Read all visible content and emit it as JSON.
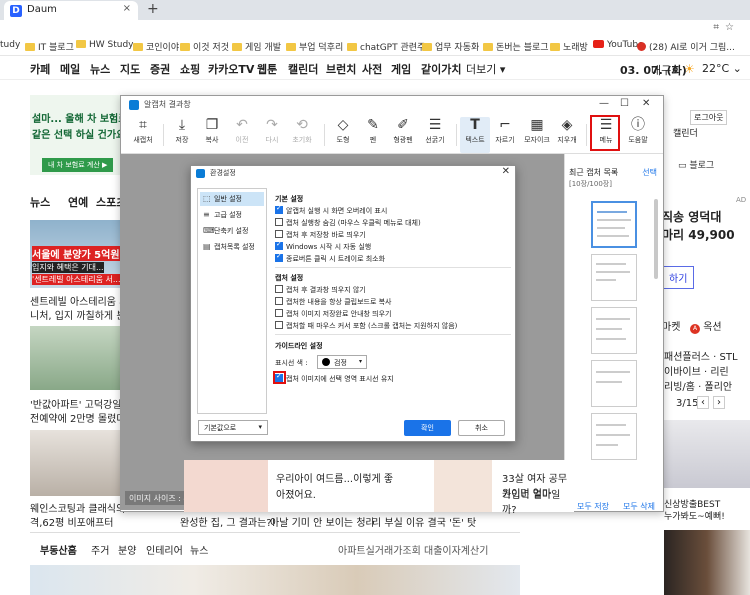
{
  "browser": {
    "tab_title": "Daum",
    "tab_close": "×",
    "new_tab": "+",
    "bookmarks": [
      {
        "label": "tudy",
        "icon": "none"
      },
      {
        "label": "IT 블로그",
        "icon": "folder"
      },
      {
        "label": "HW Study",
        "icon": "folder"
      },
      {
        "label": "코인이야",
        "icon": "folder"
      },
      {
        "label": "이것 저것",
        "icon": "folder"
      },
      {
        "label": "게임 개발",
        "icon": "folder"
      },
      {
        "label": "부업 덕후리",
        "icon": "folder"
      },
      {
        "label": "chatGPT 관련주",
        "icon": "folder"
      },
      {
        "label": "업무 자동화",
        "icon": "folder"
      },
      {
        "label": "돈버는 블로그",
        "icon": "folder"
      },
      {
        "label": "노래방",
        "icon": "folder"
      },
      {
        "label": "YouTube",
        "icon": "youtube"
      },
      {
        "label": "(28) AI로 이거 그림...",
        "icon": "red-dot"
      }
    ]
  },
  "daum_nav": {
    "items": [
      "카페",
      "메일",
      "뉴스",
      "지도",
      "증권",
      "쇼핑",
      "카카오TV",
      "웹툰",
      "캘린더",
      "브런치",
      "사전",
      "게임",
      "같이가치",
      "더보기 ▾"
    ],
    "date": "03. 07. (화)",
    "city": "대구시",
    "temp": "22°C ⌄"
  },
  "background": {
    "ad_title": "설마... 올해 차 보험료",
    "ad_sub": "같은 선택 하실 건가요",
    "ad_btn": "내 차 보험료 계산 ▶",
    "login_btn": "로그아웃",
    "calendar": "캘린더",
    "blog": "블로그",
    "tabs": [
      "뉴스",
      "연예",
      "스포츠"
    ],
    "news1_banner": "서울에 분양가 5억원",
    "news1_sub": "입지와 혜택은 기대...",
    "news1_tag": "'센트레빌 아스테리움 서...",
    "news1_text1": "센트레빌 아스테리움 시",
    "news1_text2": "니처, 입지 까칠하게 분양",
    "news2_text1": "'반값아파트' 고덕강일3",
    "news2_text2": "전예약에 2만명 몰렸다",
    "news3_text1": "웨인스코팅과 클래식의",
    "news3_text2": "격,62평 비포애프터",
    "news_bottom1": "완성한 집, 그 결과는?!",
    "news_bottom2": "아날 기미 안 보이는 청라",
    "news_bottom3": "리 부실 이유 결국 '돈' 탓",
    "bottom_nav": [
      "부동산홈",
      "주거",
      "분양",
      "인테리어",
      "뉴스"
    ],
    "bottom_right": [
      "아파트실거래가조회",
      "대출이자계산기"
    ],
    "right_ad": "AD",
    "right_text1": "직송 영덕대",
    "right_text2": "마리 49,900",
    "right_btn": "하기",
    "right_market": "마켓",
    "right_auction": "옥션",
    "right_list": [
      "패션플러스 · STL",
      "이바이브 · 리린",
      "리빙/홈 · 폴리안"
    ],
    "right_page": "3/15",
    "right_bottom1": "신상방출BEST",
    "right_bottom2": "누가봐도~예뻐!",
    "bottom_left_frag": "5+5특가모음~",
    "bottom_left_frag2": "뉴시즌 오픈 / 신상특가"
  },
  "capture_window": {
    "title": "알캡처 결과창",
    "controls": [
      "—",
      "☐",
      "✕"
    ],
    "toolbar": [
      {
        "label": "새캡처",
        "icon": "crop-icon",
        "glyph": "⌗",
        "disabled": false
      },
      {
        "label": "저장",
        "icon": "save-icon",
        "glyph": "⤓",
        "disabled": false
      },
      {
        "label": "복사",
        "icon": "copy-icon",
        "glyph": "❐",
        "disabled": false
      },
      {
        "label": "이전",
        "icon": "undo-icon",
        "glyph": "↶",
        "disabled": true
      },
      {
        "label": "다시",
        "icon": "redo-icon",
        "glyph": "↷",
        "disabled": true
      },
      {
        "label": "초기화",
        "icon": "reset-icon",
        "glyph": "⟲",
        "disabled": true
      },
      {
        "label": "도형",
        "icon": "shape-icon",
        "glyph": "◇",
        "disabled": false
      },
      {
        "label": "펜",
        "icon": "pen-icon",
        "glyph": "✎",
        "disabled": false
      },
      {
        "label": "형광펜",
        "icon": "highlighter-icon",
        "glyph": "✐",
        "disabled": false
      },
      {
        "label": "선굵기",
        "icon": "line-width-icon",
        "glyph": "☰",
        "disabled": false
      },
      {
        "label": "텍스트",
        "icon": "text-icon",
        "glyph": "T",
        "disabled": false
      },
      {
        "label": "자르기",
        "icon": "crop-tool-icon",
        "glyph": "⌐",
        "disabled": false
      },
      {
        "label": "모자이크",
        "icon": "mosaic-icon",
        "glyph": "▦",
        "disabled": false
      },
      {
        "label": "지우개",
        "icon": "eraser-icon",
        "glyph": "◈",
        "disabled": false
      },
      {
        "label": "메뉴",
        "icon": "menu-icon",
        "glyph": "☰",
        "disabled": false
      },
      {
        "label": "도움말",
        "icon": "help-icon",
        "glyph": "ⓘ",
        "disabled": false
      }
    ],
    "status": "이미지 사이즈 : 4...",
    "panel_title": "최근 캡처 목록",
    "panel_select": "선택",
    "panel_count": "[10장/100장]",
    "panel_save_all": "모두 저장",
    "panel_delete_all": "모두 삭제",
    "ad_text1": "우리아이 여드름...이렇게 좋",
    "ad_text1b": "아졌어요.",
    "ad_text2": "33살 여자 공무원이면 얼마",
    "ad_text2b": "가입비 얼마일까?"
  },
  "settings_dialog": {
    "title": "환경설정",
    "close": "✕",
    "nav": [
      {
        "label": "일반 설정",
        "icon": "general-icon",
        "glyph": "⬚",
        "selected": true
      },
      {
        "label": "고급 설정",
        "icon": "advanced-icon",
        "glyph": "≡",
        "selected": false
      },
      {
        "label": "단축키 설정",
        "icon": "shortcut-icon",
        "glyph": "⌨",
        "selected": false
      },
      {
        "label": "캡처목록 설정",
        "icon": "list-icon",
        "glyph": "▤",
        "selected": false
      }
    ],
    "reset_label": "기본값으로",
    "sections": {
      "basic": "기본 설정",
      "capture": "캡처 설정",
      "guide": "가이드라인 설정"
    },
    "basic_options": [
      {
        "label": "알캡처 실행 시 화면 오버레이 표시",
        "checked": true
      },
      {
        "label": "캡처 실행창 숨김 (마우스 우클릭 메뉴로 대체)",
        "checked": false
      },
      {
        "label": "캡처 후 저장창 바로 띄우기",
        "checked": false
      },
      {
        "label": "Windows 시작 시 자동 실행",
        "checked": true
      },
      {
        "label": "종료버튼 클릭 시 트레이로 최소화",
        "checked": true
      }
    ],
    "capture_options": [
      {
        "label": "캡처 후 결과창 띄우지 않기",
        "checked": false
      },
      {
        "label": "캡처한 내용을 항상 클립보드로 복사",
        "checked": false
      },
      {
        "label": "캡처 이미지 저장완료 안내창 띄우기",
        "checked": false
      },
      {
        "label": "캡처할 때 마우스 커서 포함 (스크롤 캡처는 지원하지 않음)",
        "checked": false
      }
    ],
    "color_label": "표시선 색 :",
    "color_value": "검정",
    "guide_option": {
      "label": "캡처 이미지에 선택 영역 표시선 유지",
      "checked": true
    },
    "ok": "확인",
    "cancel": "취소"
  }
}
